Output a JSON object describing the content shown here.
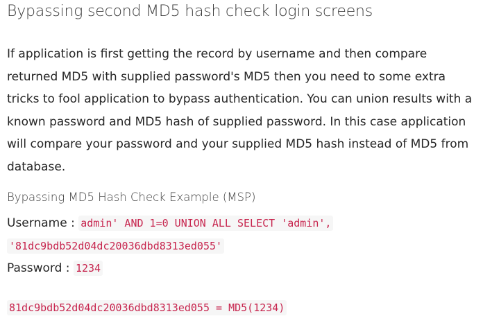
{
  "heading": "Bypassing second MD5 hash check login screens",
  "intro": "If application is first getting the record by username and then compare returned MD5 with supplied password's MD5 then you need to some extra tricks to fool application to bypass authentication. You can union results with a known password and MD5 hash of supplied password. In this case application will compare your password and your supplied MD5 hash instead of MD5 from database.",
  "example": {
    "title": "Bypassing MD5 Hash Check Example (MSP)",
    "username_label": "Username : ",
    "username_code_1": "admin' AND 1=0 UNION ALL SELECT 'admin',",
    "username_code_2": "'81dc9bdb52d04dc20036dbd8313ed055'",
    "password_label": "Password : ",
    "password_code": "1234",
    "hash_code": "81dc9bdb52d04dc20036dbd8313ed055 = MD5(1234)"
  }
}
